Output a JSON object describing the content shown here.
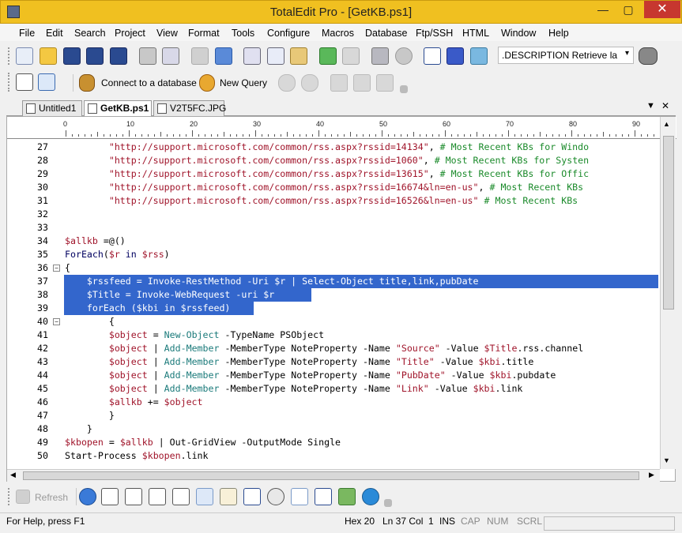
{
  "window": {
    "title": "TotalEdit Pro - [GetKB.ps1]",
    "minimize": "—",
    "maximize": "▢",
    "close": "✕"
  },
  "menu": [
    "File",
    "Edit",
    "Search",
    "Project",
    "View",
    "Format",
    "Tools",
    "Configure",
    "Macros",
    "Database",
    "Ftp/SSH",
    "HTML",
    "Window",
    "Help"
  ],
  "toolbar": {
    "description_field": ".DESCRIPTION   Retrieve la",
    "description_dropdown": "▾"
  },
  "dbbar": {
    "connect_label": "Connect to a database",
    "query_label": "New Query"
  },
  "tabs": [
    {
      "label": "Untitled1"
    },
    {
      "label": "GetKB.ps1",
      "active": true
    },
    {
      "label": "V2T5FC.JPG"
    }
  ],
  "tab_close": "✕",
  "ruler": [
    "0",
    "10",
    "20",
    "30",
    "40",
    "50",
    "60",
    "70",
    "80",
    "90"
  ],
  "code": [
    {
      "n": "27",
      "parts": [
        [
          "str",
          "\"http://support.microsoft.com/common/rss.aspx?rssid=14134\""
        ],
        [
          "op",
          ", "
        ],
        [
          "cmt",
          "# Most Recent KBs for Windo"
        ]
      ],
      "indent": "        "
    },
    {
      "n": "28",
      "parts": [
        [
          "str",
          "\"http://support.microsoft.com/common/rss.aspx?rssid=1060\""
        ],
        [
          "op",
          ", "
        ],
        [
          "cmt",
          "# Most Recent KBs for Systen"
        ]
      ],
      "indent": "        "
    },
    {
      "n": "29",
      "parts": [
        [
          "str",
          "\"http://support.microsoft.com/common/rss.aspx?rssid=13615\""
        ],
        [
          "op",
          ", "
        ],
        [
          "cmt",
          "# Most Recent KBs for Offic"
        ]
      ],
      "indent": "        "
    },
    {
      "n": "30",
      "parts": [
        [
          "str",
          "\"http://support.microsoft.com/common/rss.aspx?rssid=16674&ln=en-us\""
        ],
        [
          "op",
          ", "
        ],
        [
          "cmt",
          "# Most Recent KBs"
        ]
      ],
      "indent": "        "
    },
    {
      "n": "31",
      "parts": [
        [
          "str",
          "\"http://support.microsoft.com/common/rss.aspx?rssid=16526&ln=en-us\""
        ],
        [
          "op",
          " "
        ],
        [
          "cmt",
          "# Most Recent KBs"
        ]
      ],
      "indent": "        "
    },
    {
      "n": "32",
      "parts": [],
      "indent": ""
    },
    {
      "n": "33",
      "parts": [],
      "indent": ""
    },
    {
      "n": "34",
      "parts": [
        [
          "var",
          "$allkb"
        ],
        [
          "op",
          " =@()"
        ]
      ],
      "indent": ""
    },
    {
      "n": "35",
      "parts": [
        [
          "kw",
          "ForEach"
        ],
        [
          "op",
          "("
        ],
        [
          "var",
          "$r"
        ],
        [
          "kw",
          " in "
        ],
        [
          "var",
          "$rss"
        ],
        [
          "op",
          ")"
        ]
      ],
      "indent": ""
    },
    {
      "n": "36",
      "parts": [
        [
          "op",
          "{"
        ]
      ],
      "indent": ""
    },
    {
      "n": "37",
      "parts": [
        [
          "op",
          "$rssfeed = Invoke-RestMethod -Uri $r | Select-Object title,link,pubDate"
        ]
      ],
      "indent": "    ",
      "selected": true
    },
    {
      "n": "38",
      "parts": [
        [
          "op",
          "$Title = Invoke-WebRequest -uri $r"
        ]
      ],
      "indent": "    ",
      "selected": true
    },
    {
      "n": "39",
      "parts": [
        [
          "op",
          "forEach ($kbi in $rssfeed)"
        ]
      ],
      "indent": "    ",
      "selected": true
    },
    {
      "n": "40",
      "parts": [
        [
          "op",
          "{"
        ]
      ],
      "indent": "        "
    },
    {
      "n": "41",
      "parts": [
        [
          "var",
          "$object"
        ],
        [
          "op",
          " = "
        ],
        [
          "cmd",
          "New-Object"
        ],
        [
          "op",
          " -TypeName PSObject"
        ]
      ],
      "indent": "        "
    },
    {
      "n": "42",
      "parts": [
        [
          "var",
          "$object"
        ],
        [
          "op",
          " | "
        ],
        [
          "cmd",
          "Add-Member"
        ],
        [
          "op",
          " -MemberType NoteProperty -Name "
        ],
        [
          "str",
          "\"Source\""
        ],
        [
          "op",
          " -Value "
        ],
        [
          "var",
          "$Title"
        ],
        [
          "op",
          ".rss.channel"
        ]
      ],
      "indent": "        "
    },
    {
      "n": "43",
      "parts": [
        [
          "var",
          "$object"
        ],
        [
          "op",
          " | "
        ],
        [
          "cmd",
          "Add-Member"
        ],
        [
          "op",
          " -MemberType NoteProperty -Name "
        ],
        [
          "str",
          "\"Title\""
        ],
        [
          "op",
          " -Value "
        ],
        [
          "var",
          "$kbi"
        ],
        [
          "op",
          ".title"
        ]
      ],
      "indent": "        "
    },
    {
      "n": "44",
      "parts": [
        [
          "var",
          "$object"
        ],
        [
          "op",
          " | "
        ],
        [
          "cmd",
          "Add-Member"
        ],
        [
          "op",
          " -MemberType NoteProperty -Name "
        ],
        [
          "str",
          "\"PubDate\""
        ],
        [
          "op",
          " -Value "
        ],
        [
          "var",
          "$kbi"
        ],
        [
          "op",
          ".pubdate"
        ]
      ],
      "indent": "        "
    },
    {
      "n": "45",
      "parts": [
        [
          "var",
          "$object"
        ],
        [
          "op",
          " | "
        ],
        [
          "cmd",
          "Add-Member"
        ],
        [
          "op",
          " -MemberType NoteProperty -Name "
        ],
        [
          "str",
          "\"Link\""
        ],
        [
          "op",
          " -Value "
        ],
        [
          "var",
          "$kbi"
        ],
        [
          "op",
          ".link"
        ]
      ],
      "indent": "        "
    },
    {
      "n": "46",
      "parts": [
        [
          "var",
          "$allkb"
        ],
        [
          "op",
          " += "
        ],
        [
          "var",
          "$object"
        ]
      ],
      "indent": "        "
    },
    {
      "n": "47",
      "parts": [
        [
          "op",
          "}"
        ]
      ],
      "indent": "        "
    },
    {
      "n": "48",
      "parts": [
        [
          "op",
          "}"
        ]
      ],
      "indent": "    "
    },
    {
      "n": "49",
      "parts": [
        [
          "var",
          "$kbopen"
        ],
        [
          "op",
          " = "
        ],
        [
          "var",
          "$allkb"
        ],
        [
          "op",
          " | Out-GridView -OutputMode Single"
        ]
      ],
      "indent": ""
    },
    {
      "n": "50",
      "parts": [
        [
          "op",
          "Start-Process "
        ],
        [
          "var",
          "$kbopen"
        ],
        [
          "op",
          ".link"
        ]
      ],
      "indent": ""
    }
  ],
  "bottombar": {
    "refresh_label": "Refresh"
  },
  "status": {
    "help": "For Help, press F1",
    "hex": "Hex 20",
    "position": "Ln 37 Col  1",
    "ins": "INS",
    "cap": "CAP",
    "num": "NUM",
    "scrl": "SCRL"
  },
  "colors": {
    "titlebar": "#f0c020",
    "selection": "#3366cc",
    "close": "#c7372f"
  }
}
